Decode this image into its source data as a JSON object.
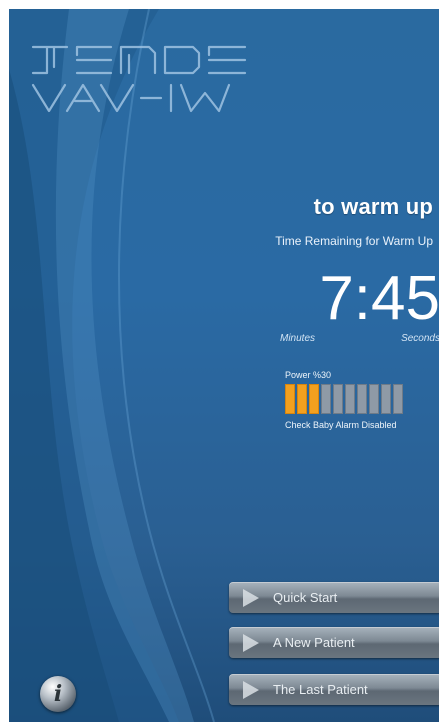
{
  "app": {
    "logo_line1": "TENDE",
    "logo_line2": "VAV-IW"
  },
  "status": {
    "headline": "to warm up",
    "subline": "Time Remaining for Warm Up"
  },
  "timer": {
    "minutes": "7",
    "separator": ":",
    "seconds": "45",
    "minutes_label": "Minutes",
    "seconds_label": "Seconds"
  },
  "power": {
    "label": "Power %30",
    "level_percent": 30,
    "segments_total": 10,
    "segments_on": 3,
    "alarm_text": "Check Baby Alarm Disabled",
    "colors": {
      "on": "#f2a01f",
      "off": "#8f9aa6"
    }
  },
  "menu": {
    "buttons": [
      {
        "label": "Quick Start",
        "icon": "play-icon"
      },
      {
        "label": "A New Patient",
        "icon": "play-icon"
      },
      {
        "label": "The Last Patient",
        "icon": "play-icon"
      }
    ]
  },
  "info_button": {
    "glyph": "i",
    "icon": "info-icon"
  },
  "colors": {
    "background": "#2a6aa0",
    "text": "#ffffff",
    "button": "#7d8994"
  }
}
